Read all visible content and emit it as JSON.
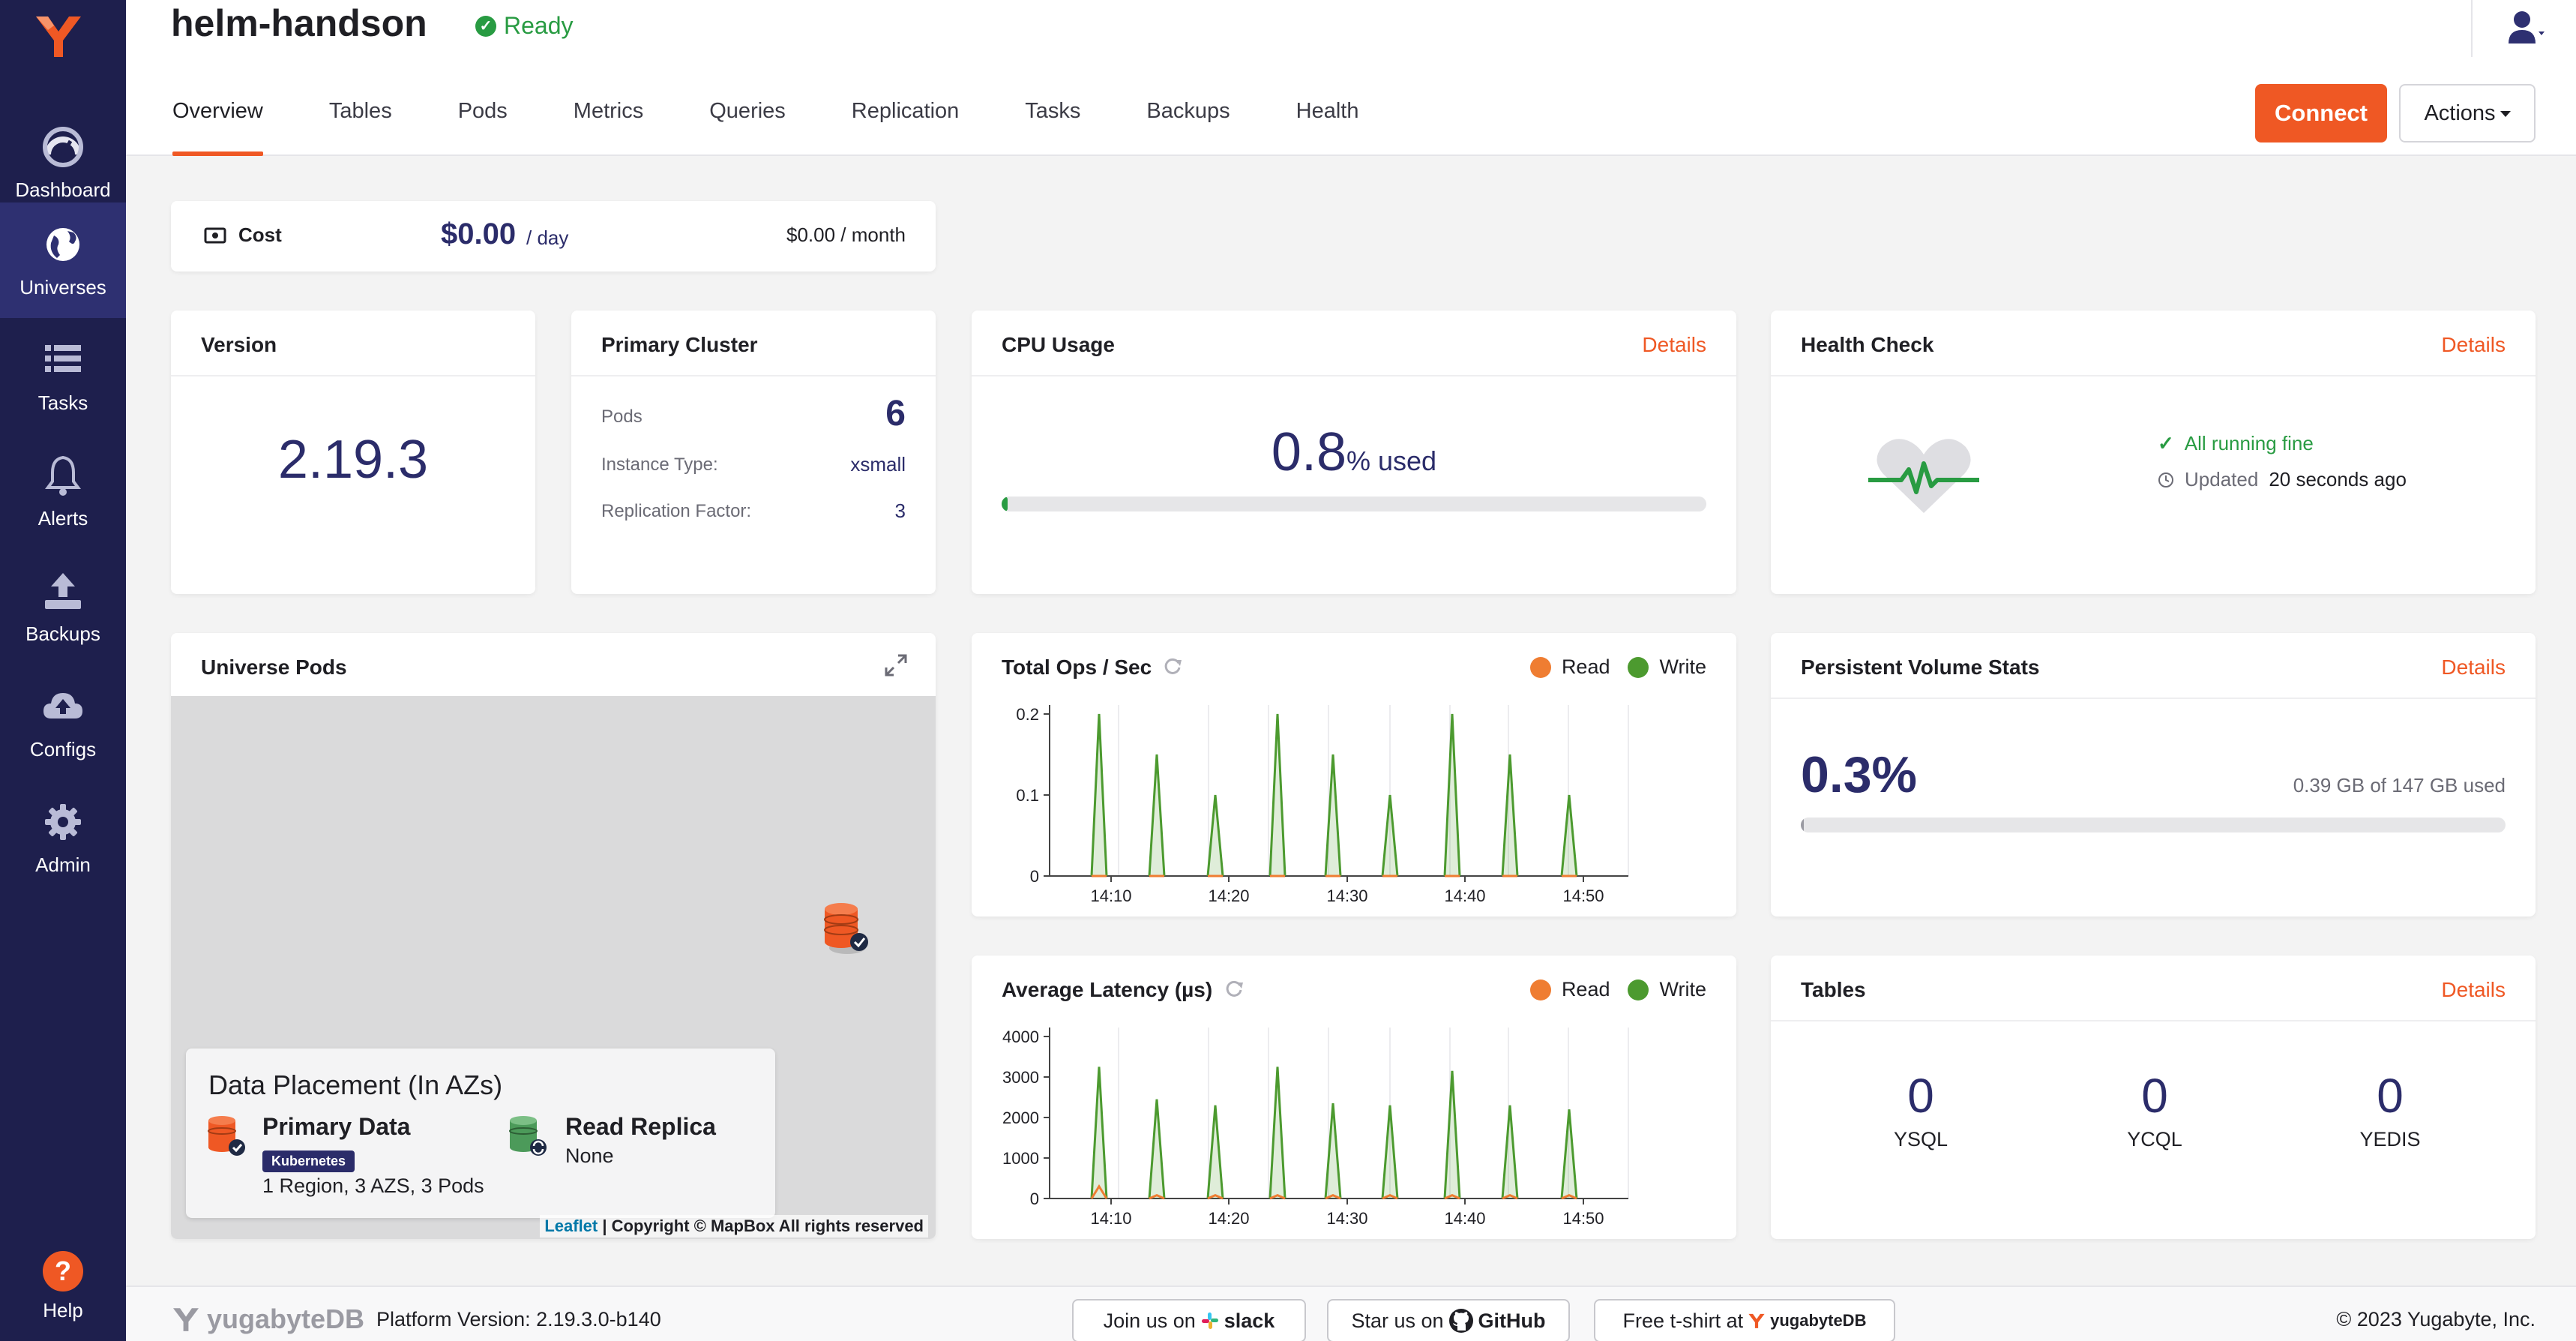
{
  "sidebar": {
    "logo": "yugabyte-logo",
    "items": [
      {
        "label": "Dashboard",
        "icon": "dashboard-icon"
      },
      {
        "label": "Universes",
        "icon": "globe-icon",
        "active": true
      },
      {
        "label": "Tasks",
        "icon": "list-icon"
      },
      {
        "label": "Alerts",
        "icon": "bell-icon"
      },
      {
        "label": "Backups",
        "icon": "upload-icon"
      },
      {
        "label": "Configs",
        "icon": "cloud-upload-icon"
      },
      {
        "label": "Admin",
        "icon": "gear-icon"
      }
    ],
    "help": {
      "label": "Help",
      "glyph": "?"
    }
  },
  "header": {
    "universe_name": "helm-handson",
    "status": "Ready",
    "tabs": [
      "Overview",
      "Tables",
      "Pods",
      "Metrics",
      "Queries",
      "Replication",
      "Tasks",
      "Backups",
      "Health"
    ],
    "active_tab": "Overview",
    "connect_label": "Connect",
    "actions_label": "Actions"
  },
  "cost": {
    "label": "Cost",
    "per_day": "$0.00",
    "per_day_unit": "/ day",
    "per_month": "$0.00 / month"
  },
  "version": {
    "title": "Version",
    "value": "2.19.3"
  },
  "primary_cluster": {
    "title": "Primary Cluster",
    "rows": [
      {
        "label": "Pods",
        "value": "6"
      },
      {
        "label": "Instance Type:",
        "value": "xsmall"
      },
      {
        "label": "Replication Factor:",
        "value": "3"
      }
    ]
  },
  "cpu": {
    "title": "CPU Usage",
    "details": "Details",
    "value": "0.8",
    "unit": "% used",
    "percent": 0.8
  },
  "health": {
    "title": "Health Check",
    "details": "Details",
    "status": "All running fine",
    "updated_prefix": "Updated",
    "updated_value": "20 seconds ago"
  },
  "universe_pods": {
    "title": "Universe Pods",
    "placement_title": "Data Placement (In AZs)",
    "primary_label": "Primary Data",
    "primary_badge": "Kubernetes",
    "primary_detail": "1 Region, 3 AZS, 3 Pods",
    "replica_label": "Read Replica",
    "replica_detail": "None",
    "attribution_leaflet": "Leaflet",
    "attribution_text": "| Copyright © MapBox All rights reserved"
  },
  "colors": {
    "read": "#ef7d32",
    "write": "#4c9a2f",
    "accent": "#ef5824",
    "navy": "#2b2c6a"
  },
  "chart_data": [
    {
      "type": "line",
      "title": "Total Ops / Sec",
      "x": [
        "14:10",
        "14:20",
        "14:30",
        "14:40",
        "14:50"
      ],
      "ylim": [
        0,
        0.2
      ],
      "yticks": [
        "0",
        "0.1",
        "0.2"
      ],
      "series": [
        {
          "name": "Read",
          "spikes": [
            0,
            0,
            0,
            0,
            0,
            0,
            0,
            0,
            0
          ]
        },
        {
          "name": "Write",
          "spikes": [
            0.2,
            0.15,
            0.1,
            0.2,
            0.15,
            0.1,
            0.2,
            0.15,
            0.1
          ]
        }
      ]
    },
    {
      "type": "line",
      "title": "Average Latency (µs)",
      "x": [
        "14:10",
        "14:20",
        "14:30",
        "14:40",
        "14:50"
      ],
      "ylim": [
        0,
        4000
      ],
      "yticks": [
        "0",
        "1000",
        "2000",
        "3000",
        "4000"
      ],
      "series": [
        {
          "name": "Read",
          "spikes": [
            300,
            80,
            80,
            80,
            80,
            80,
            80,
            80,
            80
          ]
        },
        {
          "name": "Write",
          "spikes": [
            3250,
            2450,
            2300,
            3250,
            2350,
            2300,
            3150,
            2300,
            2200
          ]
        }
      ]
    }
  ],
  "persistent_volume": {
    "title": "Persistent Volume Stats",
    "details": "Details",
    "value": "0.3%",
    "detail": "0.39 GB of 147 GB used",
    "percent": 0.3
  },
  "tables": {
    "title": "Tables",
    "details": "Details",
    "items": [
      {
        "value": "0",
        "label": "YSQL"
      },
      {
        "value": "0",
        "label": "YCQL"
      },
      {
        "value": "0",
        "label": "YEDIS"
      }
    ]
  },
  "footer": {
    "logo_text": "yugabyteDB",
    "version": "Platform Version: 2.19.3.0-b140",
    "slack": {
      "prefix": "Join us on",
      "brand": "slack"
    },
    "github": {
      "prefix": "Star us on",
      "brand": "GitHub"
    },
    "tshirt": {
      "prefix": "Free t-shirt at",
      "brand": "yugabyteDB"
    },
    "copyright": "© 2023 Yugabyte, Inc."
  }
}
